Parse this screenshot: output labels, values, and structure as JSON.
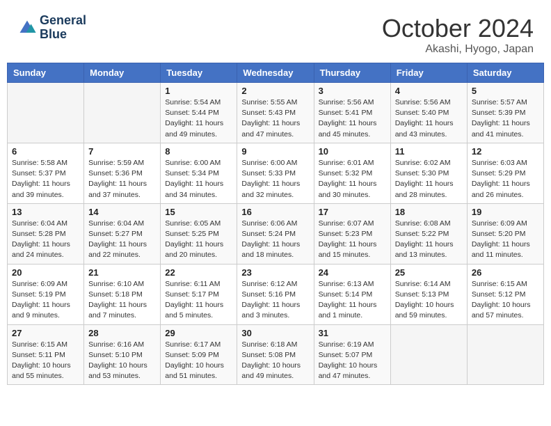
{
  "header": {
    "logo_line1": "General",
    "logo_line2": "Blue",
    "month": "October 2024",
    "location": "Akashi, Hyogo, Japan"
  },
  "days_of_week": [
    "Sunday",
    "Monday",
    "Tuesday",
    "Wednesday",
    "Thursday",
    "Friday",
    "Saturday"
  ],
  "weeks": [
    [
      {
        "day": "",
        "info": ""
      },
      {
        "day": "",
        "info": ""
      },
      {
        "day": "1",
        "info": "Sunrise: 5:54 AM\nSunset: 5:44 PM\nDaylight: 11 hours and 49 minutes."
      },
      {
        "day": "2",
        "info": "Sunrise: 5:55 AM\nSunset: 5:43 PM\nDaylight: 11 hours and 47 minutes."
      },
      {
        "day": "3",
        "info": "Sunrise: 5:56 AM\nSunset: 5:41 PM\nDaylight: 11 hours and 45 minutes."
      },
      {
        "day": "4",
        "info": "Sunrise: 5:56 AM\nSunset: 5:40 PM\nDaylight: 11 hours and 43 minutes."
      },
      {
        "day": "5",
        "info": "Sunrise: 5:57 AM\nSunset: 5:39 PM\nDaylight: 11 hours and 41 minutes."
      }
    ],
    [
      {
        "day": "6",
        "info": "Sunrise: 5:58 AM\nSunset: 5:37 PM\nDaylight: 11 hours and 39 minutes."
      },
      {
        "day": "7",
        "info": "Sunrise: 5:59 AM\nSunset: 5:36 PM\nDaylight: 11 hours and 37 minutes."
      },
      {
        "day": "8",
        "info": "Sunrise: 6:00 AM\nSunset: 5:34 PM\nDaylight: 11 hours and 34 minutes."
      },
      {
        "day": "9",
        "info": "Sunrise: 6:00 AM\nSunset: 5:33 PM\nDaylight: 11 hours and 32 minutes."
      },
      {
        "day": "10",
        "info": "Sunrise: 6:01 AM\nSunset: 5:32 PM\nDaylight: 11 hours and 30 minutes."
      },
      {
        "day": "11",
        "info": "Sunrise: 6:02 AM\nSunset: 5:30 PM\nDaylight: 11 hours and 28 minutes."
      },
      {
        "day": "12",
        "info": "Sunrise: 6:03 AM\nSunset: 5:29 PM\nDaylight: 11 hours and 26 minutes."
      }
    ],
    [
      {
        "day": "13",
        "info": "Sunrise: 6:04 AM\nSunset: 5:28 PM\nDaylight: 11 hours and 24 minutes."
      },
      {
        "day": "14",
        "info": "Sunrise: 6:04 AM\nSunset: 5:27 PM\nDaylight: 11 hours and 22 minutes."
      },
      {
        "day": "15",
        "info": "Sunrise: 6:05 AM\nSunset: 5:25 PM\nDaylight: 11 hours and 20 minutes."
      },
      {
        "day": "16",
        "info": "Sunrise: 6:06 AM\nSunset: 5:24 PM\nDaylight: 11 hours and 18 minutes."
      },
      {
        "day": "17",
        "info": "Sunrise: 6:07 AM\nSunset: 5:23 PM\nDaylight: 11 hours and 15 minutes."
      },
      {
        "day": "18",
        "info": "Sunrise: 6:08 AM\nSunset: 5:22 PM\nDaylight: 11 hours and 13 minutes."
      },
      {
        "day": "19",
        "info": "Sunrise: 6:09 AM\nSunset: 5:20 PM\nDaylight: 11 hours and 11 minutes."
      }
    ],
    [
      {
        "day": "20",
        "info": "Sunrise: 6:09 AM\nSunset: 5:19 PM\nDaylight: 11 hours and 9 minutes."
      },
      {
        "day": "21",
        "info": "Sunrise: 6:10 AM\nSunset: 5:18 PM\nDaylight: 11 hours and 7 minutes."
      },
      {
        "day": "22",
        "info": "Sunrise: 6:11 AM\nSunset: 5:17 PM\nDaylight: 11 hours and 5 minutes."
      },
      {
        "day": "23",
        "info": "Sunrise: 6:12 AM\nSunset: 5:16 PM\nDaylight: 11 hours and 3 minutes."
      },
      {
        "day": "24",
        "info": "Sunrise: 6:13 AM\nSunset: 5:14 PM\nDaylight: 11 hours and 1 minute."
      },
      {
        "day": "25",
        "info": "Sunrise: 6:14 AM\nSunset: 5:13 PM\nDaylight: 10 hours and 59 minutes."
      },
      {
        "day": "26",
        "info": "Sunrise: 6:15 AM\nSunset: 5:12 PM\nDaylight: 10 hours and 57 minutes."
      }
    ],
    [
      {
        "day": "27",
        "info": "Sunrise: 6:15 AM\nSunset: 5:11 PM\nDaylight: 10 hours and 55 minutes."
      },
      {
        "day": "28",
        "info": "Sunrise: 6:16 AM\nSunset: 5:10 PM\nDaylight: 10 hours and 53 minutes."
      },
      {
        "day": "29",
        "info": "Sunrise: 6:17 AM\nSunset: 5:09 PM\nDaylight: 10 hours and 51 minutes."
      },
      {
        "day": "30",
        "info": "Sunrise: 6:18 AM\nSunset: 5:08 PM\nDaylight: 10 hours and 49 minutes."
      },
      {
        "day": "31",
        "info": "Sunrise: 6:19 AM\nSunset: 5:07 PM\nDaylight: 10 hours and 47 minutes."
      },
      {
        "day": "",
        "info": ""
      },
      {
        "day": "",
        "info": ""
      }
    ]
  ]
}
